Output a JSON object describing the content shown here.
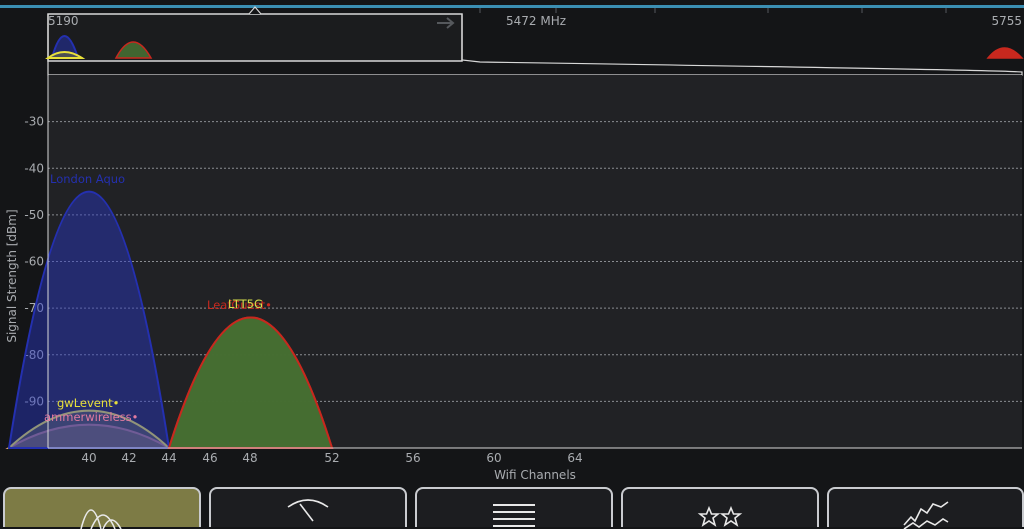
{
  "colors": {
    "background": "#141517",
    "accent_line": "#3b8fb3",
    "active_tab": "#7d7b45"
  },
  "overview": {
    "freq_left": "5190",
    "freq_mid": "5472 MHz",
    "freq_right": "5755"
  },
  "chart_data": {
    "type": "area",
    "xlabel": "Wifi Channels",
    "ylabel": "Signal Strength [dBm]",
    "x_ticks": [
      40,
      42,
      44,
      46,
      48,
      52,
      56,
      60,
      64
    ],
    "y_ticks": [
      -30,
      -40,
      -50,
      -60,
      -70,
      -80,
      -90
    ],
    "ylim": [
      -100,
      -20
    ],
    "grid": true,
    "series": [
      {
        "name": "London Aquo",
        "channel": 40,
        "width_channels": 8,
        "level_dbm": -45,
        "color": "#2430b0",
        "fill": "rgba(40,55,200,0.45)"
      },
      {
        "name": "LeafGuest",
        "channel": 48,
        "width_channels": 8,
        "level_dbm": -72,
        "color": "#c8281e",
        "fill": "rgba(70,110,50,0.9)"
      },
      {
        "name": "LTT5G",
        "channel": 48,
        "width_channels": 8,
        "level_dbm": -72,
        "color": "#c8281e",
        "fill": "rgba(70,110,50,0.9)"
      },
      {
        "name": "gwLevent",
        "channel": 40,
        "width_channels": 8,
        "level_dbm": -92,
        "color": "#e8e03a",
        "fill": "rgba(120,120,60,0.5)"
      },
      {
        "name": "ammerwireless",
        "channel": 40,
        "width_channels": 8,
        "level_dbm": -95,
        "color": "#e07aa0",
        "fill": "rgba(150,110,100,0.55)"
      }
    ]
  },
  "labels": {
    "london": "London Aquo",
    "leaf": "LeafGuest•",
    "ltt": "LTT5G",
    "gw": "gwLevent•",
    "ammer": "ammerwireless•"
  },
  "toolbar": {
    "tabs": [
      {
        "icon": "channel-graph-icon"
      },
      {
        "icon": "signal-meter-icon"
      },
      {
        "icon": "ap-list-icon"
      },
      {
        "icon": "channel-rating-icon"
      },
      {
        "icon": "time-graph-icon"
      }
    ]
  }
}
